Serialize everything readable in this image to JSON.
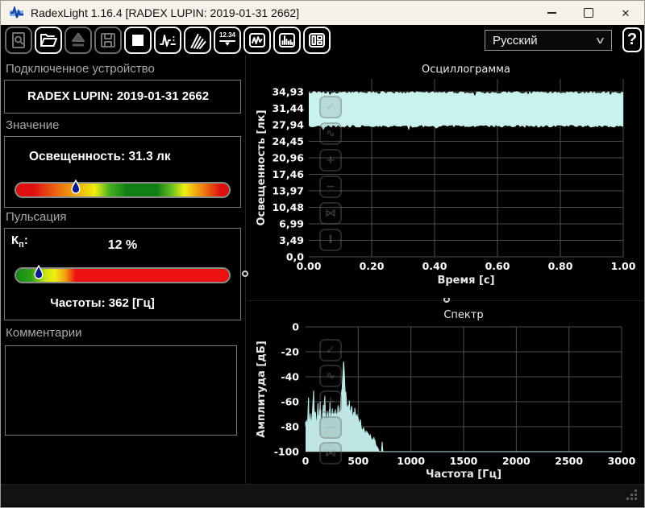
{
  "window": {
    "title": "RadexLight 1.16.4 [RADEX LUPIN: 2019-01-31 2662]",
    "close_glyph": "✕"
  },
  "toolbar": {
    "display_button_text": "12.34",
    "help_label": "?",
    "language_select": {
      "value": "Русский"
    },
    "buttons": [
      {
        "name": "zoom-preview",
        "enabled": false
      },
      {
        "name": "open-file",
        "enabled": true
      },
      {
        "name": "upload-from-device",
        "enabled": false
      },
      {
        "name": "save-file",
        "enabled": false
      },
      {
        "name": "stop-measurement",
        "enabled": true
      },
      {
        "name": "pulsation-view",
        "enabled": true
      },
      {
        "name": "rays-view",
        "enabled": true
      },
      {
        "name": "numeric-display-view",
        "enabled": true
      },
      {
        "name": "oscillogram-view",
        "enabled": true
      },
      {
        "name": "spectrum-view",
        "enabled": true
      },
      {
        "name": "layout-view",
        "enabled": true
      }
    ]
  },
  "device_section": {
    "label": "Подключенное устройство",
    "device_name": "RADEX LUPIN: 2019-01-31 2662"
  },
  "value_section": {
    "label": "Значение",
    "reading": "Освещенность: 31.3 лк",
    "scale_marker_percent": 28
  },
  "pulsation_section": {
    "label": "Пульсация",
    "kp_base": "К",
    "kp_sub": "п",
    "kp_colon": ":",
    "kp_value": "12 %",
    "scale_marker_percent": 10.5,
    "frequency": "Частоты: 362 [Гц]"
  },
  "comments_section": {
    "label": "Комментарии",
    "text": ""
  },
  "colors": {
    "waveform": "#c9f2ef",
    "waveform_line": "#b9e9e6",
    "grid": "#4e4e4e",
    "titlebar_bg": "#f6f2ea",
    "marker_fill": "#0a1a8c"
  },
  "chart_controls": {
    "buttons": [
      {
        "name": "select",
        "glyph": "✓"
      },
      {
        "name": "autoscale",
        "glyph": "∿"
      },
      {
        "name": "zoom-in",
        "glyph": "+"
      },
      {
        "name": "zoom-out",
        "glyph": "−"
      },
      {
        "name": "fit",
        "glyph": "⋈"
      },
      {
        "name": "vertical-scale",
        "glyph": "Ⅰ"
      }
    ]
  },
  "chart_data": [
    {
      "type": "area",
      "name": "oscillogram",
      "title": "Осциллограмма",
      "xlabel": "Время [с]",
      "ylabel": "Освещенность [лк]",
      "xlim": [
        0,
        1
      ],
      "xticks": [
        "0.00",
        "0.20",
        "0.40",
        "0.60",
        "0.80",
        "1.00"
      ],
      "ylim": [
        0,
        34.93
      ],
      "ytick_labels": [
        "34,93",
        "31,44",
        "27,94",
        "24,45",
        "20,96",
        "17,46",
        "13,97",
        "10,48",
        "6,99",
        "3,49",
        "0,0"
      ],
      "grid": true,
      "signal_band": {
        "min_lux": 27.9,
        "max_lux": 35.1,
        "edge_noise_lux": 0.55,
        "mean_lux": 31.3
      }
    },
    {
      "type": "area",
      "name": "spectrum",
      "title": "Спектр",
      "xlabel": "Частота [Гц]",
      "ylabel": "Амплитуда [дБ]",
      "xlim": [
        0,
        3000
      ],
      "xticks": [
        0,
        500,
        1000,
        1500,
        2000,
        2500,
        3000
      ],
      "ylim": [
        -100,
        0
      ],
      "yticks": [
        0,
        -20,
        -40,
        -60,
        -80,
        -100
      ],
      "grid": true,
      "main_peak": {
        "freq_hz": 362,
        "db": -27
      },
      "noise_db": 4,
      "envelope_points": [
        [
          0,
          -80
        ],
        [
          10,
          -74
        ],
        [
          20,
          -78
        ],
        [
          28,
          -55
        ],
        [
          33,
          -76
        ],
        [
          45,
          -70
        ],
        [
          55,
          -77
        ],
        [
          65,
          -66
        ],
        [
          77,
          -53
        ],
        [
          83,
          -74
        ],
        [
          95,
          -70
        ],
        [
          105,
          -77
        ],
        [
          118,
          -63
        ],
        [
          128,
          -76
        ],
        [
          140,
          -60
        ],
        [
          148,
          -77
        ],
        [
          158,
          -72
        ],
        [
          170,
          -64
        ],
        [
          183,
          -57
        ],
        [
          192,
          -75
        ],
        [
          205,
          -68
        ],
        [
          218,
          -76
        ],
        [
          230,
          -64
        ],
        [
          243,
          -77
        ],
        [
          255,
          -67
        ],
        [
          268,
          -74
        ],
        [
          280,
          -68
        ],
        [
          295,
          -72
        ],
        [
          310,
          -66
        ],
        [
          325,
          -70
        ],
        [
          335,
          -60
        ],
        [
          345,
          -52
        ],
        [
          355,
          -38
        ],
        [
          362,
          -27
        ],
        [
          369,
          -38
        ],
        [
          378,
          -52
        ],
        [
          388,
          -60
        ],
        [
          400,
          -66
        ],
        [
          415,
          -62
        ],
        [
          428,
          -70
        ],
        [
          440,
          -65
        ],
        [
          452,
          -72
        ],
        [
          465,
          -68
        ],
        [
          478,
          -74
        ],
        [
          490,
          -70
        ],
        [
          505,
          -78
        ],
        [
          520,
          -76
        ],
        [
          535,
          -82
        ],
        [
          550,
          -80
        ],
        [
          565,
          -85
        ],
        [
          580,
          -84
        ],
        [
          598,
          -88
        ],
        [
          615,
          -87
        ],
        [
          632,
          -91
        ],
        [
          650,
          -90
        ],
        [
          668,
          -95
        ],
        [
          685,
          -97
        ],
        [
          700,
          -100
        ],
        [
          720,
          -100
        ],
        [
          727,
          -92
        ],
        [
          734,
          -100
        ],
        [
          3000,
          -100
        ]
      ]
    }
  ]
}
